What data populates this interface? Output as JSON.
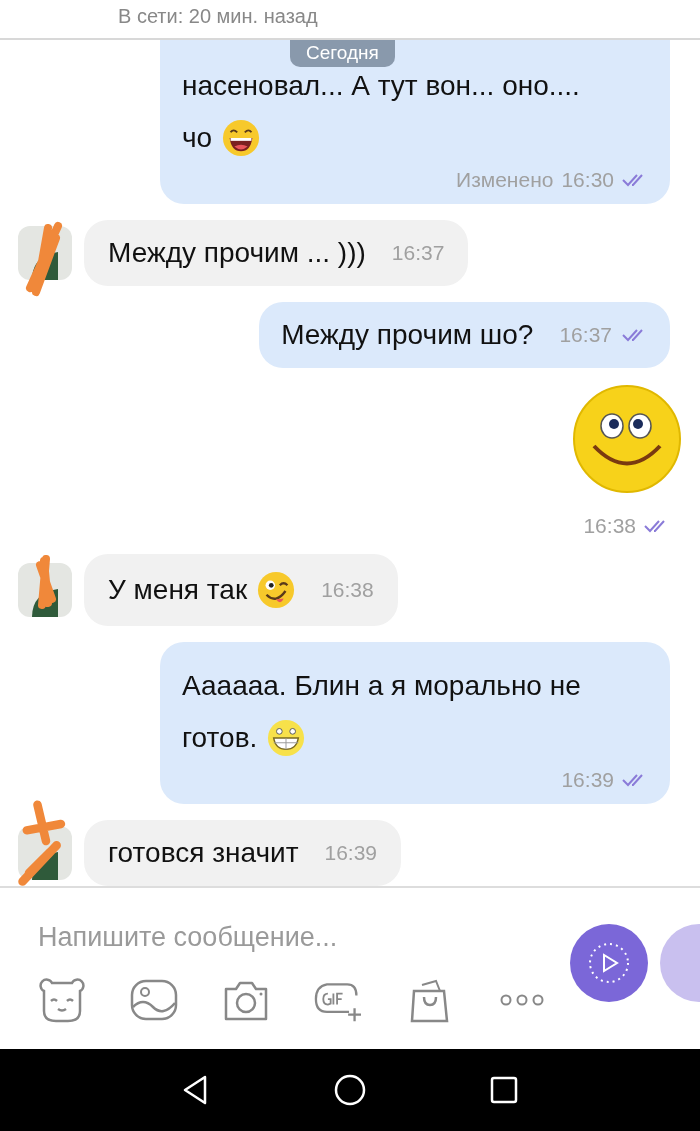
{
  "header": {
    "status": "В сети: 20 мин. назад"
  },
  "date_pill": "Сегодня",
  "messages": [
    {
      "kind": "outgoing",
      "lines": [
        "насеновал...  А тут вон... оно....",
        "чо"
      ],
      "emoji": {
        "kind": "laughing"
      },
      "edited": "Изменено",
      "time": "16:30",
      "read": true
    },
    {
      "kind": "incoming",
      "lines": [
        "Между прочим ... )))"
      ],
      "time": "16:37"
    },
    {
      "kind": "outgoing",
      "lines": [
        "Между прочим шо?"
      ],
      "time": "16:37",
      "read": true
    },
    {
      "kind": "sticker",
      "time": "16:38",
      "read": true
    },
    {
      "kind": "incoming",
      "lines": [
        "У меня так"
      ],
      "emoji": {
        "kind": "winking"
      },
      "time": "16:38"
    },
    {
      "kind": "outgoing",
      "lines": [
        "Аааааа.  Блин а я морально не",
        "готов."
      ],
      "emoji": {
        "kind": "grinning"
      },
      "time": "16:39",
      "read": true
    },
    {
      "kind": "incoming",
      "lines": [
        "готовся значит"
      ],
      "time": "16:39"
    }
  ],
  "composer": {
    "placeholder": "Напишите сообщение..."
  }
}
